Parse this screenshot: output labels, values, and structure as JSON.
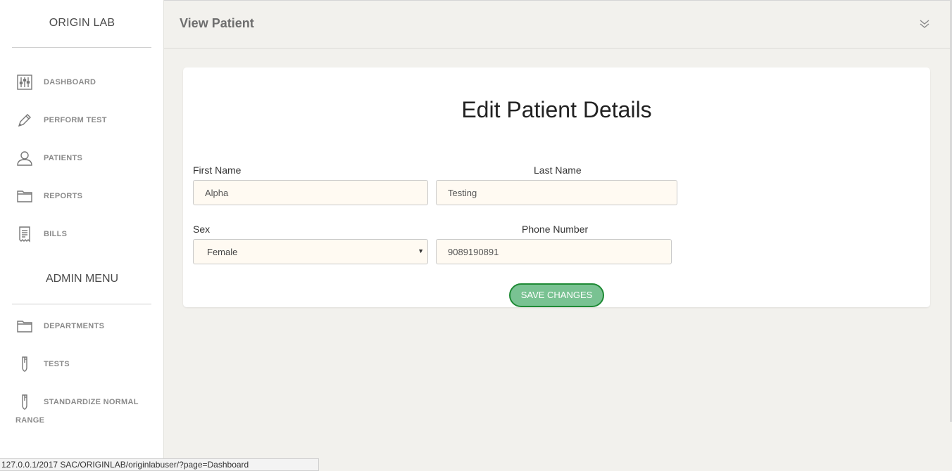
{
  "sidebar": {
    "brand": "ORIGIN LAB",
    "items": [
      {
        "label": "DASHBOARD",
        "icon": "sliders-icon"
      },
      {
        "label": "PERFORM TEST",
        "icon": "pen-icon"
      },
      {
        "label": "PATIENTS",
        "icon": "user-icon"
      },
      {
        "label": "REPORTS",
        "icon": "folder-icon"
      },
      {
        "label": "BILLS",
        "icon": "receipt-icon"
      }
    ],
    "admin_title": "ADMIN MENU",
    "admin_items": [
      {
        "label": "DEPARTMENTS",
        "icon": "folder-icon"
      },
      {
        "label": "TESTS",
        "icon": "test-tube-icon"
      },
      {
        "label": "STANDARDIZE NORMAL",
        "label_wrap": "RANGE",
        "icon": "test-tube-icon"
      }
    ]
  },
  "header": {
    "title": "View Patient",
    "collapse_icon": "double-chevron-down-icon"
  },
  "form": {
    "title": "Edit Patient Details",
    "first_name_label": "First Name",
    "first_name_value": "Alpha",
    "last_name_label": "Last Name",
    "last_name_value": "Testing",
    "sex_label": "Sex",
    "sex_value": "Female",
    "phone_label": "Phone Number",
    "phone_value": "9089190891",
    "save_label": "SAVE CHANGES"
  },
  "statusbar": {
    "url": "127.0.0.1/2017 SAC/ORIGINLAB/originlabuser/?page=Dashboard"
  },
  "colors": {
    "accent_green": "#79c292",
    "accent_green_border": "#1f8a35",
    "input_bg": "#fffaf2",
    "page_bg": "#f2f1ed"
  }
}
